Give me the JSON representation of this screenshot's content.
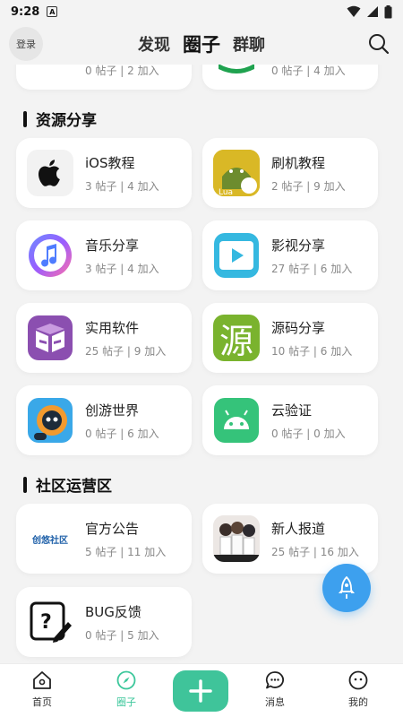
{
  "status": {
    "time": "9:28",
    "a_icon": "A"
  },
  "header": {
    "login_label": "登录",
    "tabs": [
      {
        "label": "发现",
        "active": false
      },
      {
        "label": "圈子",
        "active": true
      },
      {
        "label": "群聊",
        "active": false
      }
    ]
  },
  "partial": [
    {
      "meta": "0 帖子 | 2 加入"
    },
    {
      "meta": "0 帖子 | 4 加入"
    }
  ],
  "sections": [
    {
      "title": "资源分享",
      "items": [
        {
          "name": "iOS教程",
          "meta": "3 帖子 | 4 加入",
          "icon": "apple-icon"
        },
        {
          "name": "刷机教程",
          "meta": "2 帖子 | 9 加入",
          "icon": "android-lua-icon"
        },
        {
          "name": "音乐分享",
          "meta": "3 帖子 | 4 加入",
          "icon": "music-icon"
        },
        {
          "name": "影视分享",
          "meta": "27 帖子 | 6 加入",
          "icon": "video-play-icon"
        },
        {
          "name": "实用软件",
          "meta": "25 帖子 | 9 加入",
          "icon": "box-icon"
        },
        {
          "name": "源码分享",
          "meta": "10 帖子 | 6 加入",
          "icon": "source-code-icon",
          "glyph": "源"
        },
        {
          "name": "创游世界",
          "meta": "0 帖子 | 6 加入",
          "icon": "game-character-icon"
        },
        {
          "name": "云验证",
          "meta": "0 帖子 | 0 加入",
          "icon": "android-icon"
        }
      ]
    },
    {
      "title": "社区运营区",
      "items": [
        {
          "name": "官方公告",
          "meta": "5 帖子 | 11 加入",
          "icon": "community-logo-icon",
          "glyph": "创悠社区"
        },
        {
          "name": "新人报道",
          "meta": "25 帖子 | 16 加入",
          "icon": "anime-image-icon"
        },
        {
          "name": "BUG反馈",
          "meta": "0 帖子 | 5 加入",
          "icon": "feedback-icon"
        }
      ]
    }
  ],
  "bottom_nav": [
    {
      "label": "首页",
      "icon": "home-icon",
      "active": false
    },
    {
      "label": "圈子",
      "icon": "compass-icon",
      "active": true
    },
    {
      "label": "消息",
      "icon": "message-icon",
      "active": false
    },
    {
      "label": "我的",
      "icon": "profile-icon",
      "active": false
    }
  ],
  "colors": {
    "accent": "#3fc49a",
    "fab": "#3da0ee",
    "background": "#f3f3f3"
  }
}
